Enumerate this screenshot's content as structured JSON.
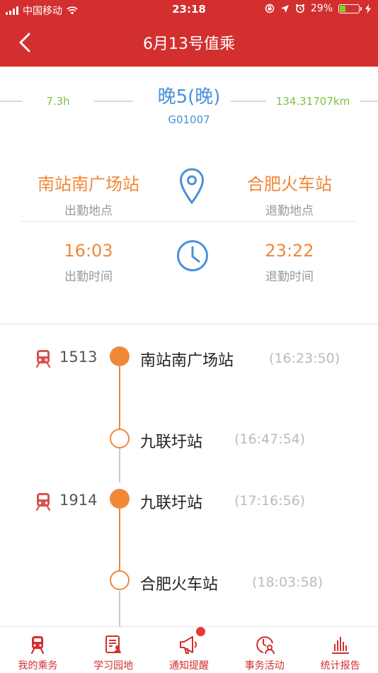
{
  "status_bar": {
    "carrier": "中国移动",
    "time": "23:18",
    "battery_percent_text": "29%",
    "battery_level": 0.29
  },
  "header": {
    "title": "6月13号值乘"
  },
  "summary": {
    "duration": "7.3h",
    "shift_name": "晚5(晚)",
    "shift_code": "G01007",
    "distance": "134.31707km",
    "start_place": "南站南广场站",
    "start_place_label": "出勤地点",
    "end_place": "合肥火车站",
    "end_place_label": "退勤地点",
    "start_time": "16:03",
    "start_time_label": "出勤时间",
    "end_time": "23:22",
    "end_time_label": "退勤时间"
  },
  "timeline": [
    {
      "train": "1513",
      "station": "南站南广场站",
      "time": "(16:23:50)",
      "dot": "filled"
    },
    {
      "train": "",
      "station": "九联圩站",
      "time": "(16:47:54)",
      "dot": "hollow"
    },
    {
      "train": "1914",
      "station": "九联圩站",
      "time": "(17:16:56)",
      "dot": "filled"
    },
    {
      "train": "",
      "station": "合肥火车站",
      "time": "(18:03:58)",
      "dot": "hollow"
    }
  ],
  "tabs": [
    {
      "label": "我的乘务",
      "icon": "train-icon"
    },
    {
      "label": "学习园地",
      "icon": "study-icon"
    },
    {
      "label": "通知提醒",
      "icon": "megaphone-icon"
    },
    {
      "label": "事务活动",
      "icon": "activity-icon"
    },
    {
      "label": "统计报告",
      "icon": "chart-icon"
    }
  ],
  "colors": {
    "brand_red": "#d32f2f",
    "accent_orange": "#f0883a",
    "accent_blue": "#4a90d9",
    "accent_green": "#7cc243"
  }
}
